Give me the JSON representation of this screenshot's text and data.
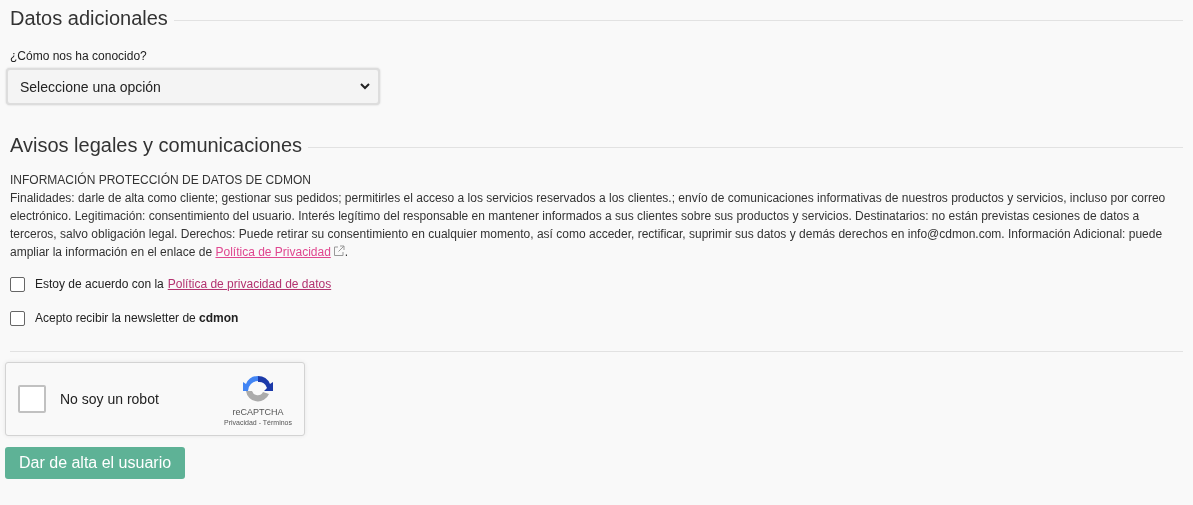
{
  "additional": {
    "title": "Datos adicionales",
    "field": {
      "label": "¿Cómo nos ha conocido?",
      "value": "Seleccione una opción"
    }
  },
  "legal": {
    "title": "Avisos legales y comunicaciones",
    "info": {
      "heading": "INFORMACIÓN PROTECCIÓN DE DATOS DE CDMON",
      "text": "Finalidades: darle de alta como cliente; gestionar sus pedidos; permitirles el acceso a los servicios reservados a los clientes.; envío de comunicaciones informativas de nuestros productos y servicios, incluso por correo electrónico. Legitimación: consentimiento del usuario. Interés legítimo del responsable en mantener informados a sus clientes sobre sus productos y servicios. Destinatarios: no están previstas cesiones de datos a terceros, salvo obligación legal. Derechos: Puede retirar su consentimiento en cualquier momento, así como acceder, rectificar, suprimir sus datos y demás derechos en info@cdmon.com. Información Adicional: puede ampliar la información en el enlace de",
      "link": "Política de Privacidad",
      "after": "."
    },
    "checkboxes": [
      {
        "text": "Estoy de acuerdo con la",
        "link": "Política de privacidad de datos",
        "checked": false
      },
      {
        "text": "Acepto recibir la newsletter de **cdmon**",
        "checked": false
      }
    ]
  },
  "captcha": {
    "label": "No soy un robot",
    "checked": false,
    "brand": "reCAPTCHA",
    "links": "Privacidad - Términos"
  },
  "submit": "Dar de alta el usuario"
}
